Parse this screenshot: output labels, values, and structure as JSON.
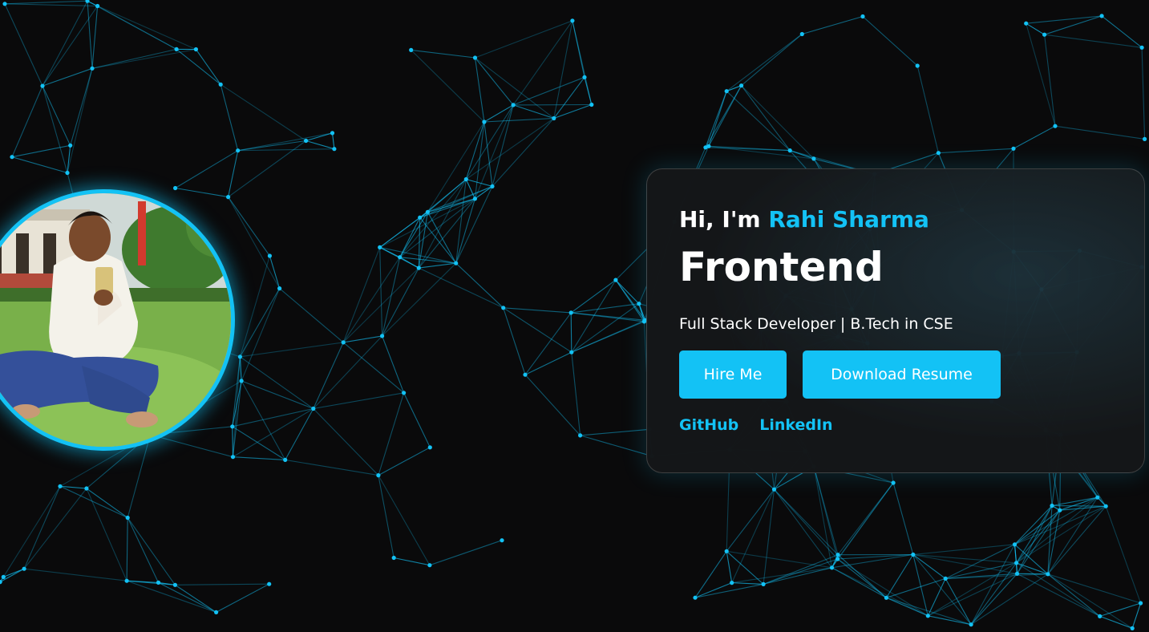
{
  "hero": {
    "greeting_prefix": "Hi, I'm ",
    "name": "Rahi Sharma",
    "role": "Frontend",
    "subtitle": "Full Stack Developer | B.Tech in CSE",
    "buttons": {
      "hire": "Hire Me",
      "resume": "Download Resume"
    },
    "links": {
      "github": "GitHub",
      "linkedin": "LinkedIn"
    }
  },
  "theme": {
    "accent": "#13c2f5",
    "background": "#0a0a0b",
    "card_text": "#ffffff"
  }
}
